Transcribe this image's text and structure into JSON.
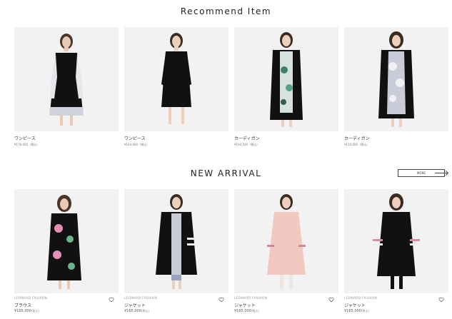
{
  "recommend": {
    "title": "Recommend Item",
    "items": [
      {
        "name": "ワンピース",
        "price": "¥176,000（税込）"
      },
      {
        "name": "ワンピース",
        "price": "¥143,000（税込）"
      },
      {
        "name": "カーディガン",
        "price": "¥104,500（税込）"
      },
      {
        "name": "カーディガン",
        "price": "¥110,000（税込）"
      }
    ]
  },
  "new_arrival": {
    "title": "NEW ARRIVAL",
    "more_label": "MORE",
    "items": [
      {
        "brand": "LEONARD FASHION",
        "name": "ブラウス",
        "price": "¥165,000",
        "tax": "(税込)"
      },
      {
        "brand": "LEONARD FASHION",
        "name": "ジャケット",
        "price": "¥165,000",
        "tax": "(税込)"
      },
      {
        "brand": "LEONARD FASHION",
        "name": "ジャケット",
        "price": "¥165,000",
        "tax": "(税込)"
      },
      {
        "brand": "LEONARD FASHION",
        "name": "ジャケット",
        "price": "¥165,000",
        "tax": "(税込)"
      }
    ]
  },
  "icons": {
    "favorite": "heart-outline-icon",
    "more": "arrow-right-icon"
  },
  "colors": {
    "photo_bg": "#f2f2f2",
    "text": "#222222",
    "muted": "#999999"
  }
}
